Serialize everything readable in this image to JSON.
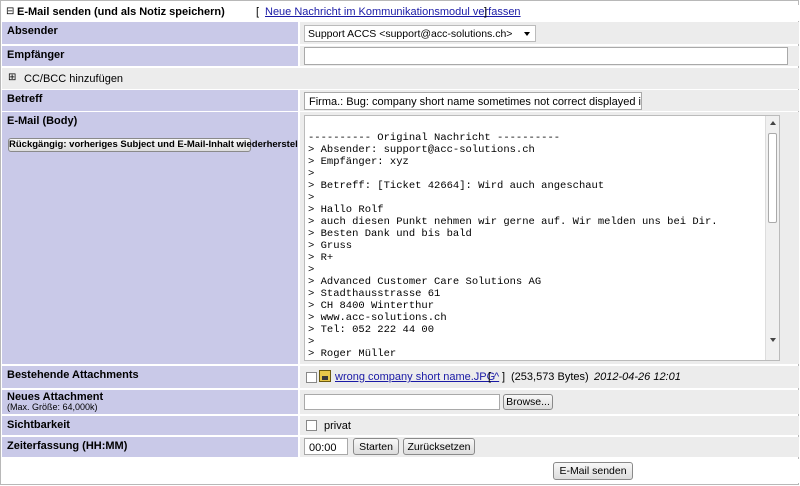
{
  "header": {
    "expand_symbol": "⊟",
    "title": "E-Mail senden (und als Notiz speichern)",
    "bracket_open": "[",
    "link": "Neue Nachricht im Kommunikationsmodul verfassen",
    "bracket_close": "]"
  },
  "sender": {
    "label": "Absender",
    "value": "Support ACCS <support@acc-solutions.ch>"
  },
  "recipient": {
    "label": "Empfänger",
    "value": ""
  },
  "ccbcc": {
    "symbol": "⊞",
    "label": "CC/BCC hinzufügen"
  },
  "subject": {
    "label": "Betreff",
    "value": "Firma.: Bug: company short name sometimes not correct displayed in filters"
  },
  "body": {
    "label": "E-Mail (Body)",
    "undo_label": "Rückgängig: vorheriges Subject und E-Mail-Inhalt wiederherstellen",
    "lines": [
      "",
      "---------- Original Nachricht ----------",
      "> Absender: support@acc-solutions.ch",
      "> Empfänger: xyz",
      ">",
      "> Betreff: [Ticket 42664]: Wird auch angeschaut",
      ">",
      "> Hallo Rolf",
      "> auch diesen Punkt nehmen wir gerne auf. Wir melden uns bei Dir.",
      "> Besten Dank und bis bald",
      "> Gruss",
      "> R+",
      ">",
      "> Advanced Customer Care Solutions AG",
      "> Stadthausstrasse 61",
      "> CH 8400 Winterthur",
      "> www.acc-solutions.ch",
      "> Tel: 052 222 44 00",
      ">",
      "> Roger Müller"
    ]
  },
  "attachments": {
    "label": "Bestehende Attachments",
    "file": "wrong company short name.JPG",
    "link_open": "[",
    "link_arrow": "^",
    "link_close": "]",
    "size": "(253,573 Bytes)",
    "date": "2012-04-26 12:01"
  },
  "new_attachment": {
    "label": "Neues Attachment",
    "hint": "(Max. Größe: 64,000k)",
    "browse": "Browse..."
  },
  "visibility": {
    "label": "Sichtbarkeit",
    "option": "privat"
  },
  "time": {
    "label": "Zeiterfassung (HH:MM)",
    "value": "00:00",
    "start": "Starten",
    "reset": "Zurücksetzen"
  },
  "send": {
    "label": "E-Mail senden"
  }
}
